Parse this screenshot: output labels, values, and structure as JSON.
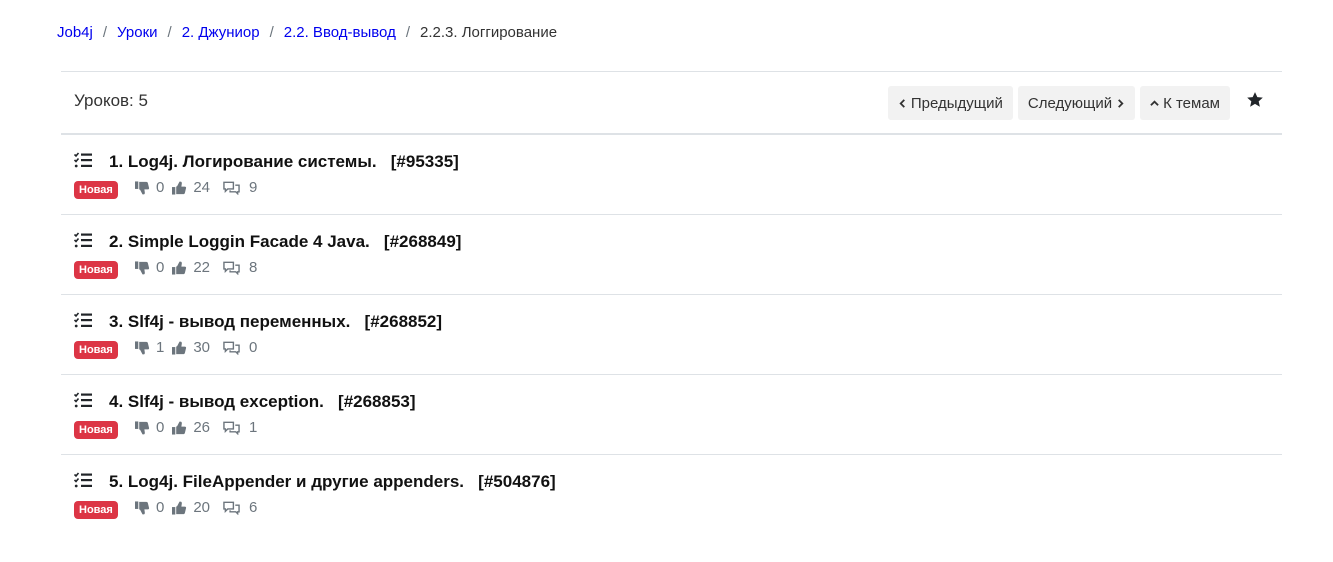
{
  "breadcrumb": {
    "items": [
      {
        "label": "Job4j"
      },
      {
        "label": "Уроки"
      },
      {
        "label": "2. Джуниор"
      },
      {
        "label": "2.2. Ввод-вывод"
      }
    ],
    "separator": "/",
    "current": "2.2.3. Логгирование"
  },
  "header": {
    "lessons_count": "Уроков: 5",
    "prev_label": "Предыдущий",
    "next_label": "Следующий",
    "topics_label": "К темам",
    "star_icon": "star-icon"
  },
  "lessons": [
    {
      "title": "1. Log4j. Логирование системы.   [#95335]",
      "badge": "Новая",
      "dislikes": "0",
      "likes": "24",
      "comments": "9"
    },
    {
      "title": "2. Simple Loggin Facade 4 Java.   [#268849]",
      "badge": "Новая",
      "dislikes": "0",
      "likes": "22",
      "comments": "8"
    },
    {
      "title": "3. Slf4j - вывод переменных.   [#268852]",
      "badge": "Новая",
      "dislikes": "1",
      "likes": "30",
      "comments": "0"
    },
    {
      "title": "4. Slf4j - вывод exception.   [#268853]",
      "badge": "Новая",
      "dislikes": "0",
      "likes": "26",
      "comments": "1"
    },
    {
      "title": "5. Log4j. FileAppender и другие appenders.   [#504876]",
      "badge": "Новая",
      "dislikes": "0",
      "likes": "20",
      "comments": "6"
    }
  ],
  "colors": {
    "link": "#0000ee",
    "badge": "#dc3545",
    "button_bg": "#f2f2f2",
    "muted": "#6c757d"
  }
}
